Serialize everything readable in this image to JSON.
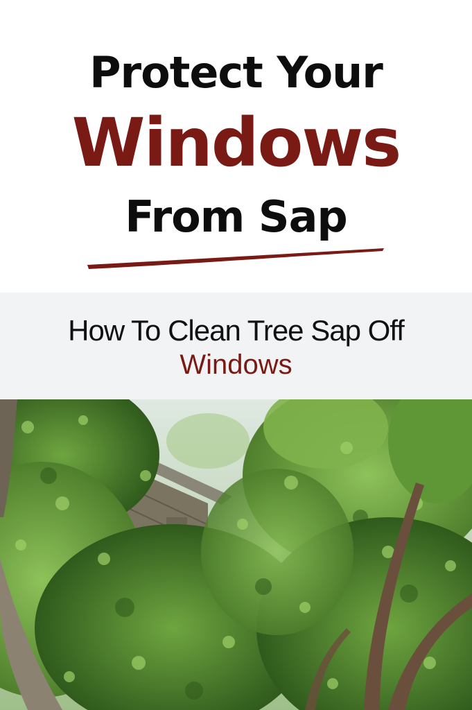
{
  "headline": {
    "line1": "Protect Your",
    "line2": "Windows",
    "line3": "From Sap"
  },
  "subheadline": {
    "line1": "How To Clean Tree Sap Off",
    "line2": "Windows"
  },
  "colors": {
    "accent": "#7a1a14",
    "text": "#0d0d0d",
    "band": "#f2f3f4"
  },
  "photo": {
    "subject": "house-roofline-behind-green-trees"
  }
}
